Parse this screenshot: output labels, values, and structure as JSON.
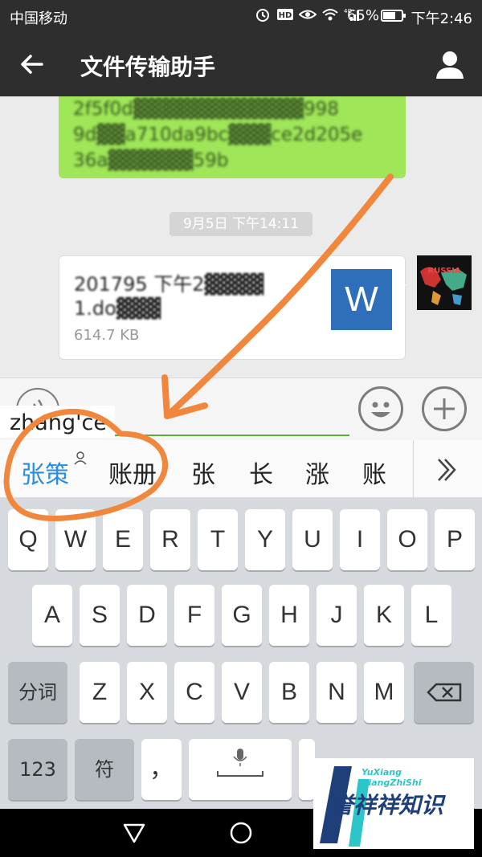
{
  "status_bar": {
    "carrier": "中国移动",
    "network": "4G",
    "battery": "65%",
    "time": "下午2:46"
  },
  "title_bar": {
    "title": "文件传输助手"
  },
  "messages": {
    "green_bubble_lines": [
      "2f5f0d▓▓▓▓▓▓▓▓▓▓▓▓998",
      "9d▓▓a710da9bc▓▓▓ce2d205e",
      "36a▓▓▓▓▓▓59b"
    ],
    "timestamp": "9月5日 下午14:11",
    "file": {
      "name_lines": [
        "201795 下午2▓▓▓▓",
        "1.do▓▓▓"
      ],
      "size": "614.7 KB",
      "icon_letter": "W"
    },
    "avatar_text": "RUSSIA"
  },
  "input": {
    "composing_text": "zhang'ce"
  },
  "candidates": [
    "张策",
    "账册",
    "张",
    "长",
    "涨",
    "账"
  ],
  "keyboard": {
    "row1": [
      "Q",
      "W",
      "E",
      "R",
      "T",
      "Y",
      "U",
      "I",
      "O",
      "P"
    ],
    "row2": [
      "A",
      "S",
      "D",
      "F",
      "G",
      "H",
      "J",
      "K",
      "L"
    ],
    "row3": [
      "Z",
      "X",
      "C",
      "V",
      "B",
      "N",
      "M"
    ],
    "fenci": "分词",
    "num": "123",
    "fu": "符",
    "comma": "，"
  },
  "watermark": {
    "line1": "YuXiang",
    "line2": "XiangZhiShi",
    "chinese": "誉祥祥知识"
  },
  "colors": {
    "header_bg": "#2e2e2e",
    "green_bubble": "#9fe658",
    "accent_blue": "#2b8ce0",
    "annotation_orange": "#f0873c",
    "word_blue": "#2f6eb8"
  }
}
